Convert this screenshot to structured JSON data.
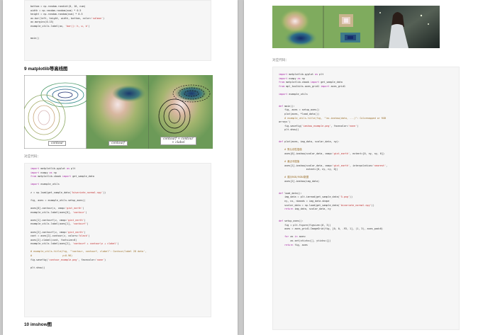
{
  "left_page": {
    "top_code": [
      "bottom = np.random.randint(0, 10, num)",
      "width = np.random.random(num) * 0.5",
      "height = np.random.random(num) * 0.5",
      "ax.bar(left, height, width, bottom, color='salmon')",
      "ax.margins(0.15)",
      "example_utils.label(ax, 'bar(): h, w, b')",
      "",
      "",
      "main()"
    ],
    "section9_title": "9 matplotlib等高线图",
    "contour_labels": [
      "contour",
      "contourf",
      "contourf + contour\n+ clabel"
    ],
    "caption": "对应代码：",
    "code2": [
      "import matplotlib.pyplot as plt",
      "import numpy as np",
      "from matplotlib.cbook import get_sample_data",
      "",
      "import example_utils",
      "",
      "z = np.load(get_sample_data('bivariate_normal.npy'))",
      "",
      "fig, axes = example_utils.setup_axes()",
      "",
      "axes[0].contour(z, cmap='gist_earth')",
      "example_utils.label(axes[0], 'contour')",
      "",
      "axes[1].contourf(z, cmap='gist_earth')",
      "example_utils.label(axes[1], 'contourf')",
      "",
      "axes[2].contourf(z, cmap='gist_earth')",
      "cont = axes[2].contour(z, colors='black')",
      "axes[2].clabel(cont, fontsize=6)",
      "example_utils.label(axes[2], 'contourf + contour\\n + clabel')",
      "",
      "# example_utils.title(fig, '\"contour, contourf, clabel\": Contour/label 2D data',",
      "#                     y=0.96)",
      "fig.savefig('contour_example.png', facecolor='none')",
      "",
      "plt.show()"
    ],
    "section10_title": "10 imshow图"
  },
  "right_page": {
    "caption": "对应代码：",
    "code": [
      "import matplotlib.pyplot as plt",
      "import numpy as np",
      "from matplotlib.cbook import get_sample_data",
      "from mpl_toolkits.axes_grid1 import axes_grid1",
      "",
      "import example_utils",
      "",
      "",
      "def main():",
      "    fig, axes = setup_axes()",
      "    plot(axes, *load_data())",
      "    # example_utils.title(fig, '\"ax.imshow(data, ...)\": Colormapped or RGB",
      "arrays')",
      "    fig.savefig('imshow_example.png', facecolor='none')",
      "    plt.show()",
      "",
      "",
      "def plot(axes, img_data, scalar_data, ny):",
      "",
      "    # 默认线性插值",
      "    axes[0].imshow(scalar_data, cmap='gist_earth', extent=[0, ny, ny, 0])",
      "",
      "    # 最近邻插值",
      "    axes[1].imshow(scalar_data, cmap='gist_earth', interpolation='nearest',",
      "                   extent=[0, ny, ny, 0])",
      "",
      "    # 展示RGB/RGBA数据",
      "    axes[2].imshow(img_data)",
      "",
      "",
      "def load_data():",
      "    img_data = plt.imread(get_sample_data('5.png'))",
      "    ny, nx, nbands = img_data.shape",
      "    scalar_data = np.load(get_sample_data('bivariate_normal.npy'))",
      "    return img_data, scalar_data, ny",
      "",
      "",
      "def setup_axes():",
      "    fig = plt.figure(figsize=(6, 3))",
      "    axes = axes_grid1.ImageGrid(fig, [0, 0, .93, 1], (1, 3), axes_pad=0)",
      "",
      "    for ax in axes:",
      "        ax.set(xticks=[], yticks=[])",
      "    return fig, axes"
    ]
  },
  "colors": {
    "page_bg": "#c9c9c9",
    "code_bg": "#f6f6f6",
    "keyword": "#a626a4",
    "string": "#c02f2f",
    "comment": "#9a6f2a"
  }
}
